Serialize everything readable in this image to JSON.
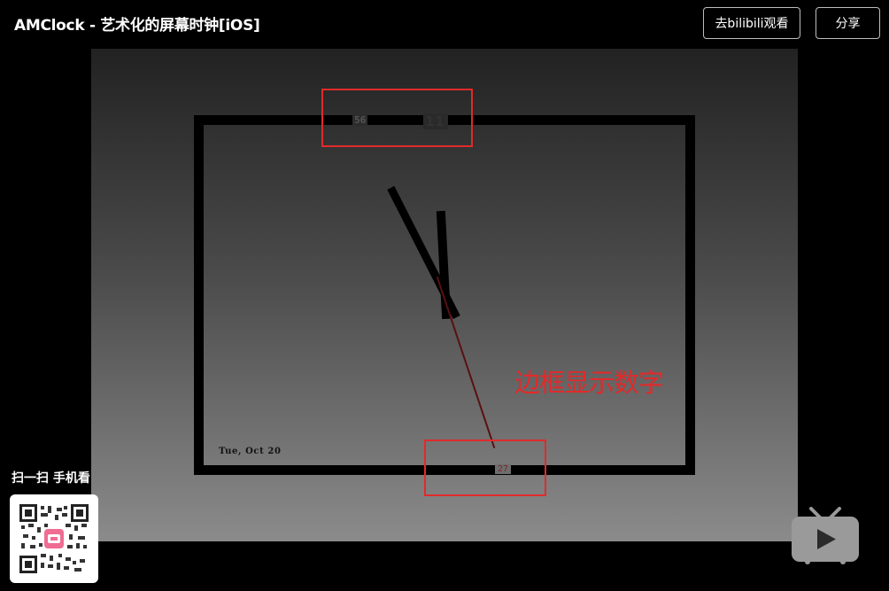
{
  "header": {
    "title": "AMClock - 艺术化的屏幕时钟[iOS]",
    "watch_on_bilibili_label": "去bilibili观看",
    "share_label": "分享"
  },
  "video": {
    "clock": {
      "minute_number": "56",
      "hour_number": "11",
      "second_number": "27",
      "date": "Tue, Oct 20"
    },
    "annotation": "边框显示数字"
  },
  "mobile": {
    "scan_label": "扫一扫 手机看"
  },
  "icons": {
    "play": "tv-play-icon",
    "qr": "qr-code"
  },
  "colors": {
    "annotation_red": "#e12a2a",
    "background": "#000000"
  }
}
